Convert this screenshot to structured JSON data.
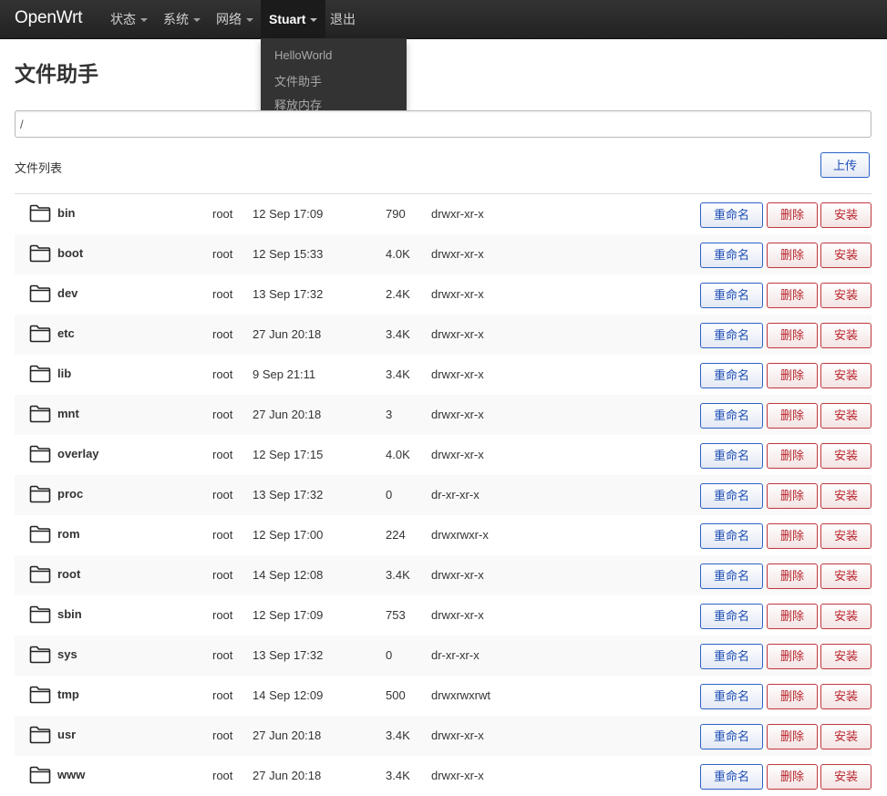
{
  "navbar": {
    "brand": "OpenWrt",
    "menu": [
      "状态",
      "系统",
      "网络",
      "Stuart",
      "退出"
    ]
  },
  "dropdown": {
    "items": [
      "HelloWorld",
      "文件助手",
      "释放内存"
    ]
  },
  "page": {
    "title": "文件助手",
    "path_value": "/",
    "list_label": "文件列表",
    "upload_label": "上传"
  },
  "actions": {
    "rename": "重命名",
    "delete": "删除",
    "install": "安装"
  },
  "files": [
    {
      "name": "bin",
      "owner": "root",
      "date": "12 Sep 17:09",
      "size": "790",
      "perm": "drwxr-xr-x"
    },
    {
      "name": "boot",
      "owner": "root",
      "date": "12 Sep 15:33",
      "size": "4.0K",
      "perm": "drwxr-xr-x"
    },
    {
      "name": "dev",
      "owner": "root",
      "date": "13 Sep 17:32",
      "size": "2.4K",
      "perm": "drwxr-xr-x"
    },
    {
      "name": "etc",
      "owner": "root",
      "date": "27 Jun 20:18",
      "size": "3.4K",
      "perm": "drwxr-xr-x"
    },
    {
      "name": "lib",
      "owner": "root",
      "date": "9 Sep 21:11",
      "size": "3.4K",
      "perm": "drwxr-xr-x"
    },
    {
      "name": "mnt",
      "owner": "root",
      "date": "27 Jun 20:18",
      "size": "3",
      "perm": "drwxr-xr-x"
    },
    {
      "name": "overlay",
      "owner": "root",
      "date": "12 Sep 17:15",
      "size": "4.0K",
      "perm": "drwxr-xr-x"
    },
    {
      "name": "proc",
      "owner": "root",
      "date": "13 Sep 17:32",
      "size": "0",
      "perm": "dr-xr-xr-x"
    },
    {
      "name": "rom",
      "owner": "root",
      "date": "12 Sep 17:00",
      "size": "224",
      "perm": "drwxrwxr-x"
    },
    {
      "name": "root",
      "owner": "root",
      "date": "14 Sep 12:08",
      "size": "3.4K",
      "perm": "drwxr-xr-x"
    },
    {
      "name": "sbin",
      "owner": "root",
      "date": "12 Sep 17:09",
      "size": "753",
      "perm": "drwxr-xr-x"
    },
    {
      "name": "sys",
      "owner": "root",
      "date": "13 Sep 17:32",
      "size": "0",
      "perm": "dr-xr-xr-x"
    },
    {
      "name": "tmp",
      "owner": "root",
      "date": "14 Sep 12:09",
      "size": "500",
      "perm": "drwxrwxrwt"
    },
    {
      "name": "usr",
      "owner": "root",
      "date": "27 Jun 20:18",
      "size": "3.4K",
      "perm": "drwxr-xr-x"
    },
    {
      "name": "www",
      "owner": "root",
      "date": "27 Jun 20:18",
      "size": "3.4K",
      "perm": "drwxr-xr-x"
    }
  ],
  "icons": {
    "folder": "folder-icon",
    "caret": "chevron-down-icon"
  }
}
